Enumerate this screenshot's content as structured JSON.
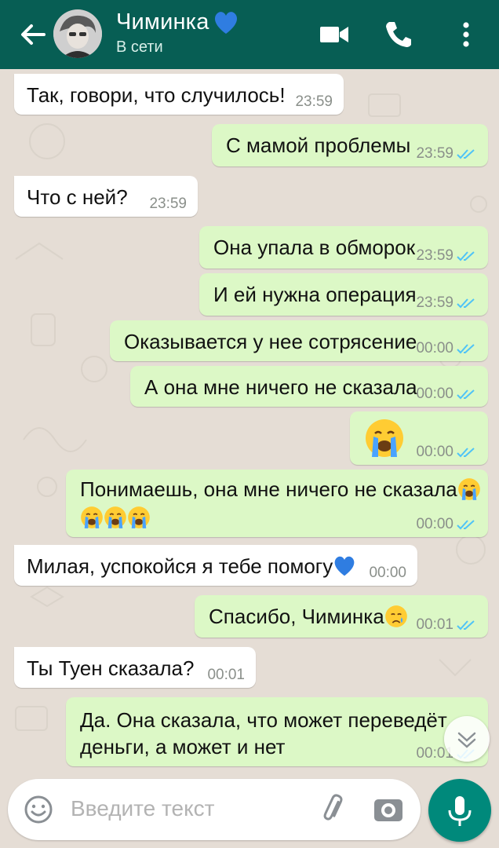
{
  "header": {
    "contact_name": "Чиминка",
    "status": "В сети",
    "back_icon": "arrow-back-icon",
    "video_icon": "video-call-icon",
    "call_icon": "phone-icon",
    "menu_icon": "more-vert-icon"
  },
  "messages": [
    {
      "dir": "in",
      "text": "Так, говори, что случилось!",
      "time": "23:59"
    },
    {
      "dir": "out",
      "text": "С мамой проблемы",
      "time": "23:59"
    },
    {
      "dir": "in",
      "text": "Что с ней?",
      "time": "23:59"
    },
    {
      "dir": "out",
      "text": "Она упала в обморок",
      "time": "23:59"
    },
    {
      "dir": "out",
      "text": "И ей нужна операция",
      "time": "23:59"
    },
    {
      "dir": "out",
      "text": "Оказывается у нее сотрясение",
      "time": "00:00"
    },
    {
      "dir": "out",
      "text": "А она мне ничего не сказала",
      "time": "00:00"
    },
    {
      "dir": "out",
      "text": "",
      "emoji": "crying-face",
      "time": "00:00"
    },
    {
      "dir": "out",
      "text": "Понимаешь, она мне ничего не сказала",
      "time": "00:00"
    },
    {
      "dir": "in",
      "text": "Милая, успокойся я тебе помогу",
      "time": "00:00"
    },
    {
      "dir": "out",
      "text": "Спасибо, Чиминка",
      "time": "00:01"
    },
    {
      "dir": "in",
      "text": "Ты Туен сказала?",
      "time": "00:01"
    },
    {
      "dir": "out",
      "text": "Да. Она сказала, что может переведёт деньги, а может и нет",
      "text_line1": "Да. Она сказала, что может переведёт",
      "text_line2": "деньги, а может и нет",
      "time": "00:01"
    }
  ],
  "input": {
    "placeholder": "Введите текст"
  },
  "colors": {
    "header": "#075e54",
    "outgoing_bubble": "#dcf8c6",
    "incoming_bubble": "#ffffff",
    "read_ticks": "#4fc3f7",
    "mic_button": "#00897b"
  }
}
